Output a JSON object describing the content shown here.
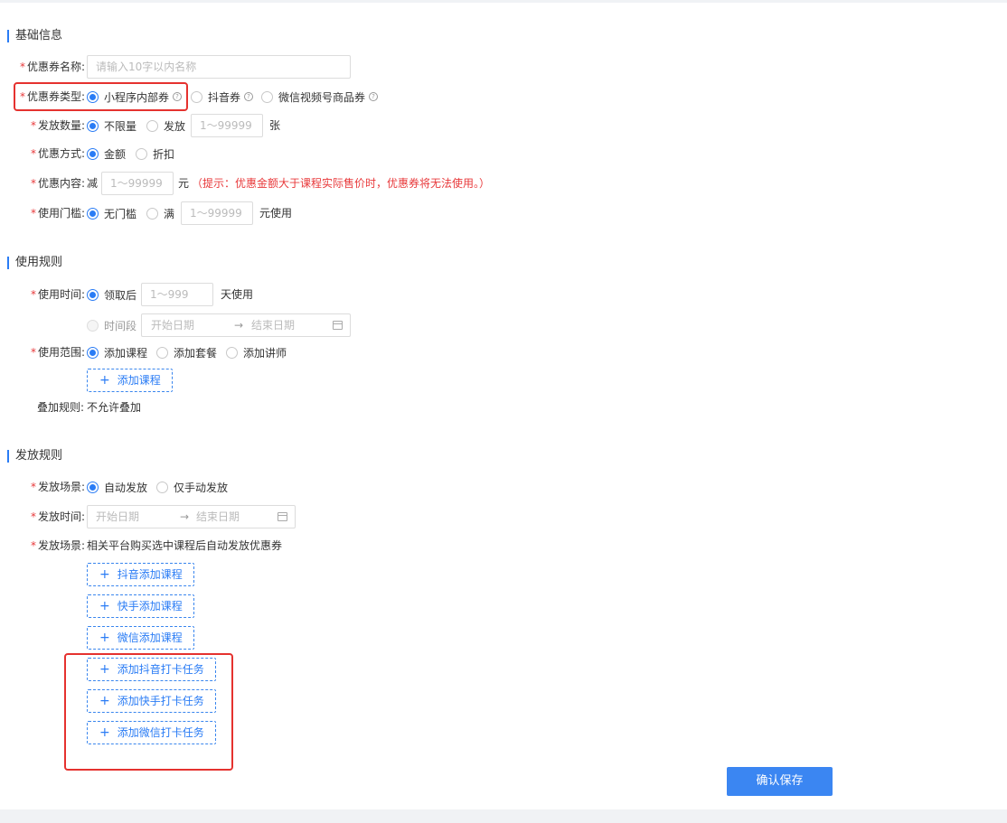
{
  "sections": {
    "basic": "基础信息",
    "rules": "使用规则",
    "issue": "发放规则"
  },
  "basic": {
    "name_label": "优惠券名称:",
    "name_placeholder": "请输入10字以内名称",
    "type_label": "优惠券类型:",
    "type_options": [
      "小程序内部券",
      "抖音券",
      "微信视频号商品券"
    ],
    "qty_label": "发放数量:",
    "qty_unlimited": "不限量",
    "qty_issue": "发放",
    "qty_placeholder": "1～99999",
    "qty_unit": "张",
    "method_label": "优惠方式:",
    "method_amount": "金额",
    "method_discount": "折扣",
    "content_label": "优惠内容:",
    "content_prefix": "减",
    "content_placeholder": "1～99999",
    "content_unit": "元",
    "content_hint": "（提示：优惠金额大于课程实际售价时，优惠券将无法使用。）",
    "threshold_label": "使用门槛:",
    "threshold_none": "无门槛",
    "threshold_full": "满",
    "threshold_placeholder": "1～99999",
    "threshold_unit": "元使用"
  },
  "rules": {
    "time_label": "使用时间:",
    "time_after": "领取后",
    "time_placeholder": "1～999",
    "time_unit": "天使用",
    "time_range": "时间段",
    "start_date": "开始日期",
    "end_date": "结束日期",
    "arrow": "→",
    "scope_label": "使用范围:",
    "scope_options": [
      "添加课程",
      "添加套餐",
      "添加讲师"
    ],
    "add_course": "添加课程",
    "stack_label": "叠加规则:",
    "stack_value": "不允许叠加"
  },
  "issue": {
    "scene_label": "发放场景:",
    "scene_auto": "自动发放",
    "scene_manual": "仅手动发放",
    "time_label": "发放时间:",
    "start_date": "开始日期",
    "end_date": "结束日期",
    "arrow": "→",
    "scene2_label": "发放场景:",
    "scene2_value": "相关平台购买选中课程后自动发放优惠券",
    "buttons": [
      "抖音添加课程",
      "快手添加课程",
      "微信添加课程",
      "添加抖音打卡任务",
      "添加快手打卡任务",
      "添加微信打卡任务"
    ]
  },
  "footer": {
    "save": "确认保存"
  },
  "common": {
    "required": "*",
    "plus": "+",
    "question": "?"
  },
  "colors": {
    "accent": "#2a7cf5",
    "required": "#e8393b",
    "highlight_box": "#e5322f",
    "primary_button": "#3b86f2"
  }
}
